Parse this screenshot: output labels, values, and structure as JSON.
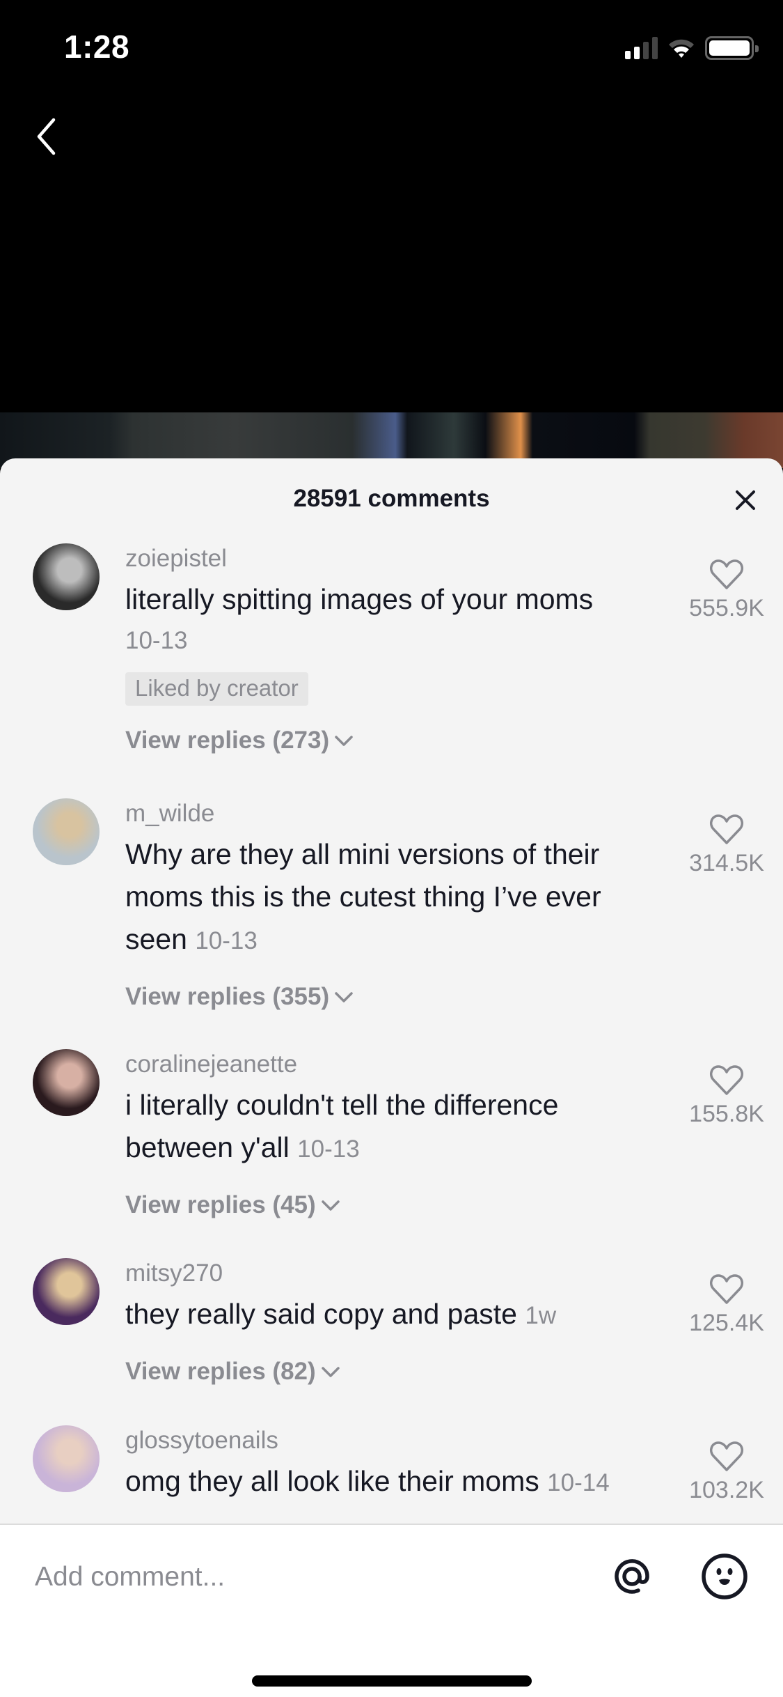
{
  "status_bar": {
    "time": "1:28",
    "signal_bars_active": 2,
    "signal_bars_total": 4,
    "wifi_icon": "wifi-icon",
    "battery_icon": "battery-icon"
  },
  "nav": {
    "back_icon": "chevron-left-icon"
  },
  "sheet": {
    "title": "28591 comments",
    "close_icon": "close-icon"
  },
  "comments": [
    {
      "username": "zoiepistel",
      "text": "literally spitting images of your moms",
      "date": "10-13",
      "date_on_own_line": true,
      "badge": "Liked by creator",
      "replies_label": "View replies (273)",
      "likes": "555.9K",
      "avatar_colors": [
        "#2a2a2a",
        "#bdbdbd"
      ]
    },
    {
      "username": "m_wilde",
      "text": "Why are they all mini versions of their moms this is the cutest thing I’ve ever seen",
      "date": "10-13",
      "date_on_own_line": false,
      "badge": null,
      "replies_label": "View replies (355)",
      "likes": "314.5K",
      "avatar_colors": [
        "#b9c4cc",
        "#d8c3a0"
      ]
    },
    {
      "username": "coralinejeanette",
      "text": "i literally couldn't tell the difference between y'all",
      "date": "10-13",
      "date_on_own_line": false,
      "badge": null,
      "replies_label": "View replies (45)",
      "likes": "155.8K",
      "avatar_colors": [
        "#2a1a1e",
        "#d7b0a4"
      ]
    },
    {
      "username": "mitsy270",
      "text": "they really said copy and paste",
      "date": "1w",
      "date_on_own_line": false,
      "badge": null,
      "replies_label": "View replies (82)",
      "likes": "125.4K",
      "avatar_colors": [
        "#4a2a5e",
        "#e0c59a"
      ]
    },
    {
      "username": "glossytoenails",
      "text": "omg they all look like their moms",
      "date": "10-14",
      "date_on_own_line": false,
      "badge": null,
      "replies_label": null,
      "likes": "103.2K",
      "avatar_colors": [
        "#c9b4d8",
        "#e8cfc2"
      ]
    }
  ],
  "footer": {
    "placeholder": "Add comment...",
    "mention_icon": "at-sign-icon",
    "emoji_icon": "emoji-icon"
  },
  "colors": {
    "sheet_bg": "#f4f4f4",
    "primary_text": "#161823",
    "secondary_text": "#8a8b91",
    "badge_bg": "#e6e6e6"
  }
}
